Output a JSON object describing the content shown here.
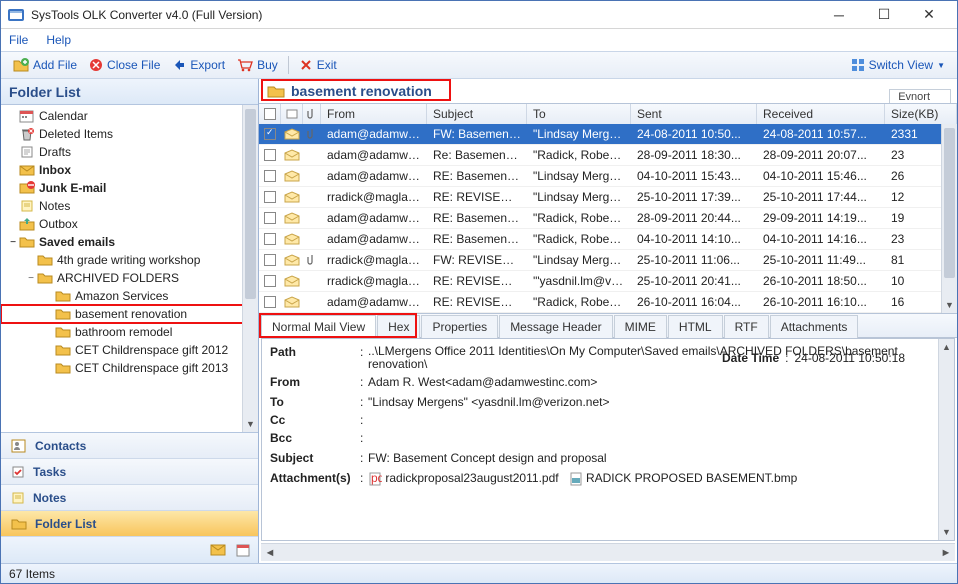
{
  "window": {
    "title": "SysTools OLK Converter v4.0 (Full Version)"
  },
  "menu": [
    "File",
    "Help"
  ],
  "toolbar": {
    "addfile": "Add File",
    "closefile": "Close File",
    "export": "Export",
    "buy": "Buy",
    "exit": "Exit",
    "switchview": "Switch View"
  },
  "leftpane": {
    "title": "Folder List",
    "tree": [
      {
        "indent": 0,
        "tw": "",
        "icon": "calendar",
        "label": "Calendar"
      },
      {
        "indent": 0,
        "tw": "",
        "icon": "deleted",
        "label": "Deleted Items"
      },
      {
        "indent": 0,
        "tw": "",
        "icon": "drafts",
        "label": "Drafts"
      },
      {
        "indent": 0,
        "tw": "",
        "icon": "inbox",
        "label": "Inbox",
        "bold": true
      },
      {
        "indent": 0,
        "tw": "",
        "icon": "junk",
        "label": "Junk E-mail",
        "bold": true
      },
      {
        "indent": 0,
        "tw": "",
        "icon": "notes",
        "label": "Notes"
      },
      {
        "indent": 0,
        "tw": "",
        "icon": "outbox",
        "label": "Outbox"
      },
      {
        "indent": 0,
        "tw": "−",
        "icon": "folder",
        "label": "Saved emails",
        "bold": true
      },
      {
        "indent": 1,
        "tw": "",
        "icon": "folder",
        "label": "4th grade writing workshop"
      },
      {
        "indent": 1,
        "tw": "−",
        "icon": "folder",
        "label": "ARCHIVED FOLDERS"
      },
      {
        "indent": 2,
        "tw": "",
        "icon": "folder",
        "label": "Amazon Services"
      },
      {
        "indent": 2,
        "tw": "",
        "icon": "folder",
        "label": "basement renovation",
        "hl": true
      },
      {
        "indent": 2,
        "tw": "",
        "icon": "folder",
        "label": "bathroom remodel"
      },
      {
        "indent": 2,
        "tw": "",
        "icon": "folder",
        "label": "CET Childrenspace gift 2012"
      },
      {
        "indent": 2,
        "tw": "",
        "icon": "folder",
        "label": "CET Childrenspace gift 2013"
      }
    ],
    "nav": [
      {
        "icon": "contacts",
        "label": "Contacts"
      },
      {
        "icon": "tasks",
        "label": "Tasks"
      },
      {
        "icon": "notes",
        "label": "Notes"
      },
      {
        "icon": "folderlist",
        "label": "Folder List",
        "sel": true
      }
    ]
  },
  "content": {
    "folder": "basement renovation",
    "exportbtn": "Evnort",
    "columns": [
      "",
      "",
      "",
      "From",
      "Subject",
      "To",
      "Sent",
      "Received",
      "Size(KB)"
    ],
    "rows": [
      {
        "sel": true,
        "chk": true,
        "attach": true,
        "from": "adam@adamwes...",
        "subj": "FW: Basement C...",
        "to": "\"Lindsay Mergen...",
        "sent": "24-08-2011 10:50...",
        "recv": "24-08-2011 10:57...",
        "size": "2331"
      },
      {
        "from": "adam@adamwes...",
        "subj": "Re: Basement Co...",
        "to": "\"Radick, Robert ...",
        "sent": "28-09-2011 18:30...",
        "recv": "28-09-2011 20:07...",
        "size": "23"
      },
      {
        "from": "adam@adamwes...",
        "subj": "RE: Basement Co...",
        "to": "\"Lindsay Mergen...",
        "sent": "04-10-2011 15:43...",
        "recv": "04-10-2011 15:46...",
        "size": "26"
      },
      {
        "from": "rradick@maglaw...",
        "subj": "RE: REVISED PR...",
        "to": "\"Lindsay Mergen...",
        "sent": "25-10-2011 17:39...",
        "recv": "25-10-2011 17:44...",
        "size": "12"
      },
      {
        "from": "adam@adamwes...",
        "subj": "RE: Basement Co...",
        "to": "\"Radick, Robert ...",
        "sent": "28-09-2011 20:44...",
        "recv": "29-09-2011 14:19...",
        "size": "19"
      },
      {
        "from": "adam@adamwes...",
        "subj": "RE: Basement Co...",
        "to": "\"Radick, Robert ...",
        "sent": "04-10-2011 14:10...",
        "recv": "04-10-2011 14:16...",
        "size": "23"
      },
      {
        "attach": true,
        "from": "rradick@maglaw...",
        "subj": "FW: REVISED PR...",
        "to": "\"Lindsay Mergen...",
        "sent": "25-10-2011 11:06...",
        "recv": "25-10-2011 11:49...",
        "size": "81"
      },
      {
        "from": "rradick@maglaw...",
        "subj": "RE: REVISED PR...",
        "to": "'\"yasdnil.lm@veri...",
        "sent": "25-10-2011 20:41...",
        "recv": "26-10-2011 18:50...",
        "size": "10"
      },
      {
        "from": "adam@adamwes...",
        "subj": "RE: REVISED PR...",
        "to": "\"Radick, Robert ...",
        "sent": "26-10-2011 16:04...",
        "recv": "26-10-2011 16:10...",
        "size": "16"
      }
    ],
    "tabs": [
      "Normal Mail View",
      "Hex",
      "Properties",
      "Message Header",
      "MIME",
      "HTML",
      "RTF",
      "Attachments"
    ],
    "detail": {
      "datetime_label": "Date Time",
      "datetime": "24-08-2011 10:50:18",
      "path_label": "Path",
      "path": "..\\LMergens  Office 2011 Identities\\On My Computer\\Saved emails\\ARCHIVED FOLDERS\\basement renovation\\",
      "from_label": "From",
      "from": "Adam R. West<adam@adamwestinc.com>",
      "to_label": "To",
      "to": "\"Lindsay Mergens\" <yasdnil.lm@verizon.net>",
      "cc_label": "Cc",
      "cc": "",
      "bcc_label": "Bcc",
      "bcc": "",
      "subject_label": "Subject",
      "subject": "FW: Basement Concept design and proposal",
      "attach_label": "Attachment(s)",
      "attach1": "radickproposal23august2011.pdf",
      "attach2": "RADICK PROPOSED BASEMENT.bmp"
    }
  },
  "status": "67 Items"
}
